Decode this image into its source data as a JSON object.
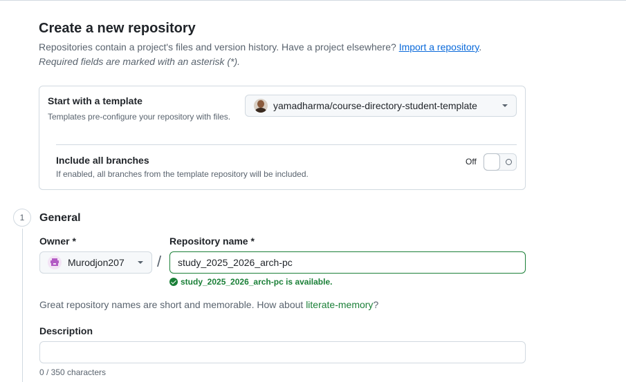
{
  "header": {
    "title": "Create a new repository",
    "subtitle_text": "Repositories contain a project's files and version history. Have a project elsewhere? ",
    "import_link": "Import a repository",
    "subtitle_end": ".",
    "required_note": "Required fields are marked with an asterisk (*)."
  },
  "template": {
    "title": "Start with a template",
    "description": "Templates pre-configure your repository with files.",
    "selected": "yamadharma/course-directory-student-template",
    "include_branches_title": "Include all branches",
    "include_branches_desc": "If enabled, all branches from the template repository will be included.",
    "toggle_state": "Off"
  },
  "general": {
    "step_number": "1",
    "title": "General",
    "owner_label": "Owner *",
    "owner_value": "Murodjon207",
    "slash": "/",
    "repo_label": "Repository name *",
    "repo_value": "study_2025_2026_arch-pc",
    "available_msg": "study_2025_2026_arch-pc is available.",
    "suggestion_text": "Great repository names are short and memorable. How about ",
    "suggestion_link": "literate-memory",
    "suggestion_end": "?",
    "description_label": "Description",
    "description_value": "",
    "char_count": "0 / 350 characters"
  },
  "colors": {
    "success": "#1a7f37",
    "link": "#0969da",
    "muted": "#59636e",
    "border": "#d1d9e0"
  },
  "icons": [
    "user-avatar",
    "owner-identicon",
    "caret-down-icon",
    "check-circle-icon",
    "toggle-off-icon"
  ]
}
